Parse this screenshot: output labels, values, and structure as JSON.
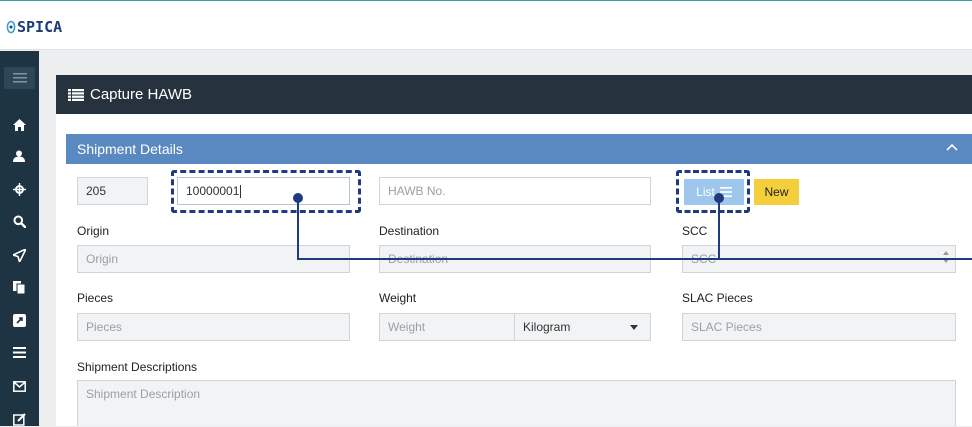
{
  "app": {
    "logo_text": "SPICA"
  },
  "page": {
    "title": "Capture HAWB"
  },
  "section": {
    "title": "Shipment Details"
  },
  "form": {
    "prefix_value": "205",
    "awb_value": "10000001",
    "hawb_placeholder": "HAWB No.",
    "list_button": "List",
    "new_button": "New",
    "origin_label": "Origin",
    "origin_placeholder": "Origin",
    "destination_label": "Destination",
    "destination_placeholder": "Destination",
    "scc_label": "SCC",
    "scc_placeholder": "SCC",
    "pieces_label": "Pieces",
    "pieces_placeholder": "Pieces",
    "weight_label": "Weight",
    "weight_placeholder": "Weight",
    "weight_unit": "Kilogram",
    "slac_label": "SLAC Pieces",
    "slac_placeholder": "SLAC Pieces",
    "desc_label": "Shipment Descriptions",
    "desc_placeholder": "Shipment Description"
  },
  "sidebar": {
    "icons": [
      "home-icon",
      "user-icon",
      "crosshair-icon",
      "search-icon",
      "send-icon",
      "documents-icon",
      "external-link-icon",
      "list-icon",
      "envelope-icon",
      "edit-icon"
    ]
  },
  "colors": {
    "sidebar": "#1e3443",
    "panel_header": "#26333e",
    "section_header": "#5a88c0",
    "list_button": "#9fc6ec",
    "new_button": "#f5ce3b",
    "annotation": "#1f3b80"
  }
}
